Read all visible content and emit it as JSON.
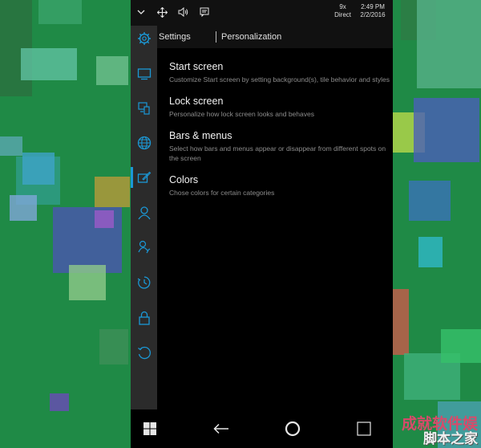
{
  "wallpaper": {
    "base_color": "#1f8a46",
    "tiles": [
      {
        "color": "#3aa36a"
      },
      {
        "color": "#6fbf8e"
      },
      {
        "color": "#2f9c8a"
      },
      {
        "color": "#3fa3c8"
      },
      {
        "color": "#b89a3a"
      },
      {
        "color": "#7fa6d8"
      },
      {
        "color": "#4a55b0"
      },
      {
        "color": "#9b5ac8"
      },
      {
        "color": "#8ec98a"
      },
      {
        "color": "#3d8e58"
      },
      {
        "color": "#5aa7b0"
      },
      {
        "color": "#6a4ab8"
      },
      {
        "color": "#2e7a45"
      },
      {
        "color": "#b8d84a"
      },
      {
        "color": "#4a5fb8"
      },
      {
        "color": "#3a72b8"
      },
      {
        "color": "#2fb8c8"
      },
      {
        "color": "#c85a4a"
      },
      {
        "color": "#3fb07a"
      },
      {
        "color": "#36c06a"
      },
      {
        "color": "#56b088"
      },
      {
        "color": "#4aa0b0"
      },
      {
        "color": "#2a6f3e"
      },
      {
        "color": "#5fc0a0"
      }
    ]
  },
  "status_bar": {
    "signal_text": "9x",
    "network": "Direct",
    "time": "2:49 PM",
    "date": "2/2/2016",
    "icons": [
      "chevron-down-icon",
      "move-icon",
      "volume-icon",
      "message-icon"
    ]
  },
  "header": {
    "root": "Settings",
    "page": "Personalization"
  },
  "rail": {
    "accent": "#1b98d6",
    "icons": [
      "gear-icon",
      "system-icon",
      "devices-icon",
      "globe-icon",
      "personalization-icon",
      "person-icon",
      "accessibility-icon",
      "time-language-icon",
      "lock-icon",
      "update-icon"
    ],
    "active_index": 4
  },
  "items": [
    {
      "title": "Start screen",
      "desc": "Customize Start screen by setting background(s), tile behavior and styles"
    },
    {
      "title": "Lock screen",
      "desc": "Personalize how lock screen looks and behaves"
    },
    {
      "title": "Bars & menus",
      "desc": "Select how bars and menus appear or disappear from different spots on the screen"
    },
    {
      "title": "Colors",
      "desc": "Chose colors for certain categories"
    }
  ],
  "navbar": {
    "icons": [
      "windows-icon",
      "back-icon",
      "home-circle-icon",
      "search-icon"
    ]
  },
  "watermark": {
    "line1": "成就软件娱",
    "line2": "脚本之家"
  }
}
